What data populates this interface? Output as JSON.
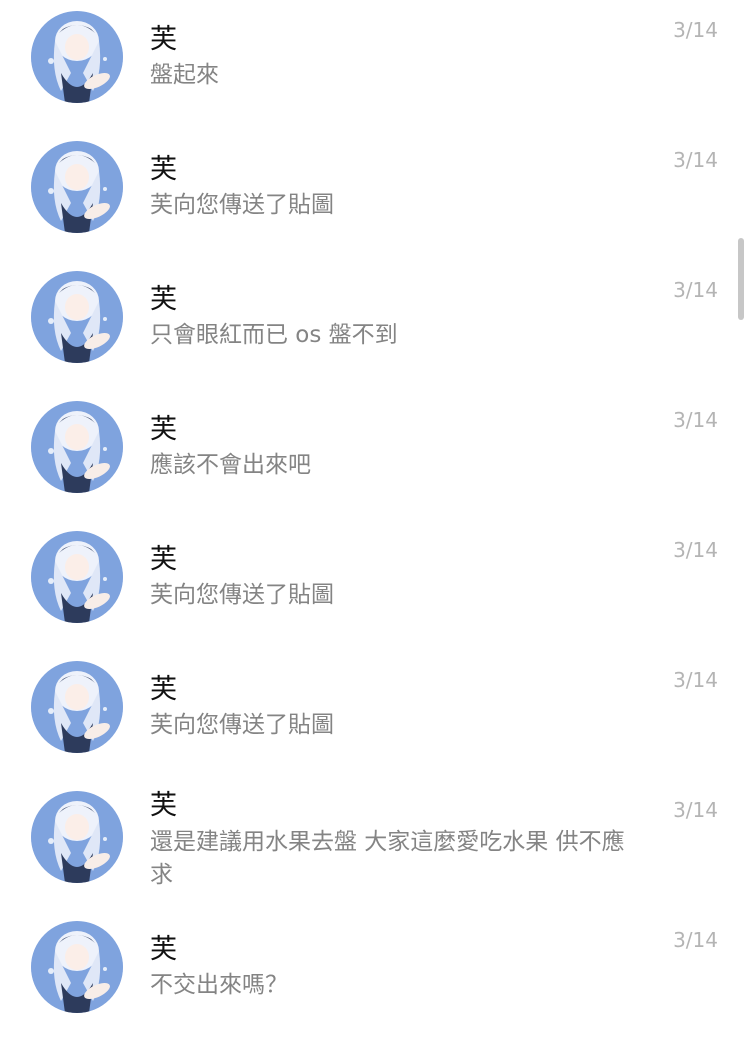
{
  "conversations": [
    {
      "name": "芙",
      "message": "盤起來",
      "date": "3/14"
    },
    {
      "name": "芙",
      "message": "芙向您傳送了貼圖",
      "date": "3/14"
    },
    {
      "name": "芙",
      "message": "只會眼紅而已 os 盤不到",
      "date": "3/14"
    },
    {
      "name": "芙",
      "message": "應該不會出來吧",
      "date": "3/14"
    },
    {
      "name": "芙",
      "message": "芙向您傳送了貼圖",
      "date": "3/14"
    },
    {
      "name": "芙",
      "message": "芙向您傳送了貼圖",
      "date": "3/14"
    },
    {
      "name": "芙",
      "message": "還是建議用水果去盤 大家這麼愛吃水果 供不應求",
      "date": "3/14"
    },
    {
      "name": "芙",
      "message": "不交出來嗎？",
      "date": "3/14"
    }
  ],
  "colors": {
    "name_text": "#111111",
    "message_text": "#848484",
    "date_text": "#b4b4b4",
    "scrollbar": "#c7c7c7",
    "background": "#ffffff"
  },
  "icons": {
    "avatar": "anime-character-avatar"
  }
}
